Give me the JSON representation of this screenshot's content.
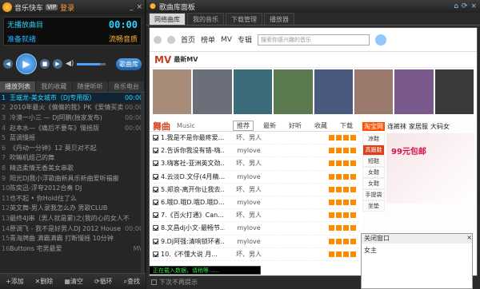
{
  "player": {
    "title": "音乐快车",
    "vip": "VIP",
    "login": "登录",
    "lcd_line1": "无播放曲目",
    "lcd_time": "00:00",
    "lcd_status": "准备就绪",
    "lcd_fx": "流畅音质",
    "lyric_btn": "歌曲库",
    "tabs": [
      "播放列表",
      "我的收藏",
      "随便听听",
      "音乐电台"
    ],
    "playlist": [
      {
        "n": "1",
        "title": "王璀龙-美女城市（DJ专用版）",
        "tag": "00:00"
      },
      {
        "n": "2",
        "title": "2010年最火《偏偏的我》PK《爱情买卖》",
        "tag": "00:00"
      },
      {
        "n": "3",
        "title": "冷漠一小三 — DJ阿鹏(独家发布)",
        "tag": "00:00"
      },
      {
        "n": "4",
        "title": "赵本水—《痛后不要车》慢摇版",
        "tag": "00:00"
      },
      {
        "n": "5",
        "title": "蓝调慢摇",
        "tag": ""
      },
      {
        "n": "6",
        "title": "《丹动一分钟》12 莫贝对不起",
        "tag": ""
      },
      {
        "n": "7",
        "title": "吹嘛机组己的舞",
        "tag": ""
      },
      {
        "n": "8",
        "title": "精选柔情无香美女串歌",
        "tag": ""
      },
      {
        "n": "9",
        "title": "阳光DJ我小浮歌曲新具乐新曲爱听福搬",
        "tag": ""
      },
      {
        "n": "10",
        "title": "陈奕迅-浮夸2012合奏 DJ",
        "tag": ""
      },
      {
        "n": "11",
        "title": "也不起 • 你Hold住了么",
        "tag": ""
      },
      {
        "n": "12",
        "title": "英文舞-男人录我怎么办 男歌CLUB",
        "tag": ""
      },
      {
        "n": "13",
        "title": "最终4J串（男人就是累)之(我的心的女人不",
        "tag": ""
      },
      {
        "n": "14",
        "title": "原调飞 - 我不是好男人DJ 2012 House",
        "tag": "00:00"
      },
      {
        "n": "15",
        "title": "青海牌曲 满霸满霸 打断慢摇 10分钟",
        "tag": ""
      },
      {
        "n": "16",
        "title": "Buttons 宅男最爱",
        "tag": "MV"
      }
    ],
    "bottom": [
      "+添加",
      "✕删除",
      "▦清空",
      "⟳循环",
      "⌕查找"
    ]
  },
  "panel": {
    "title": "歌曲库面板",
    "tabs": [
      "网络曲库",
      "我的音乐",
      "下载管理",
      "播放器"
    ],
    "nav": [
      "首页",
      "榜单",
      "MV",
      "专辑"
    ],
    "search_placeholder": "搜索你感兴趣的音乐",
    "mv_label": "MV",
    "mv_sub": "最新MV",
    "section_title": "舞曲",
    "section_sub": "Music",
    "section_tabs": [
      "推荐",
      "最新",
      "好听",
      "收藏",
      "下载"
    ],
    "songs": [
      {
        "name": "1.我是不是你最疼爱...",
        "artist": "坏、男人"
      },
      {
        "name": "2.告诉你我没有错-嗨...",
        "artist": "mylove"
      },
      {
        "name": "3.嗨客社-亚洲英文劲...",
        "artist": "坏、男人"
      },
      {
        "name": "4.云淡D.文仔(4月精...",
        "artist": "mylove"
      },
      {
        "name": "5.郑浪-离开你让我去...",
        "artist": "坏、男人"
      },
      {
        "name": "6.哦D.哦D.哦D.哦D...",
        "artist": "mylove"
      },
      {
        "name": "7.《百火打通》Can...",
        "artist": "坏、男人"
      },
      {
        "name": "8.文昌dj小文-最畅节...",
        "artist": "mylove"
      },
      {
        "name": "9.Dj阿强:清响锁环者...",
        "artist": "mylove"
      },
      {
        "name": "10.《不懂大说 月...",
        "artist": "坏、男人"
      }
    ],
    "ad": {
      "brand": "淘宝网",
      "items": [
        "连裤袜",
        "家居服",
        "大码女"
      ],
      "side": [
        "凉鞋",
        "高跟鞋",
        "短鞋",
        "女鞋",
        "女鞋",
        "手提袋",
        "坐垫"
      ],
      "baoyou": "99元包邮"
    },
    "popup_title": "关闭窗口",
    "popup_text": "女主",
    "status_text": "正在载入数据，请稍等......",
    "no_prompt": "下次不再提示"
  }
}
